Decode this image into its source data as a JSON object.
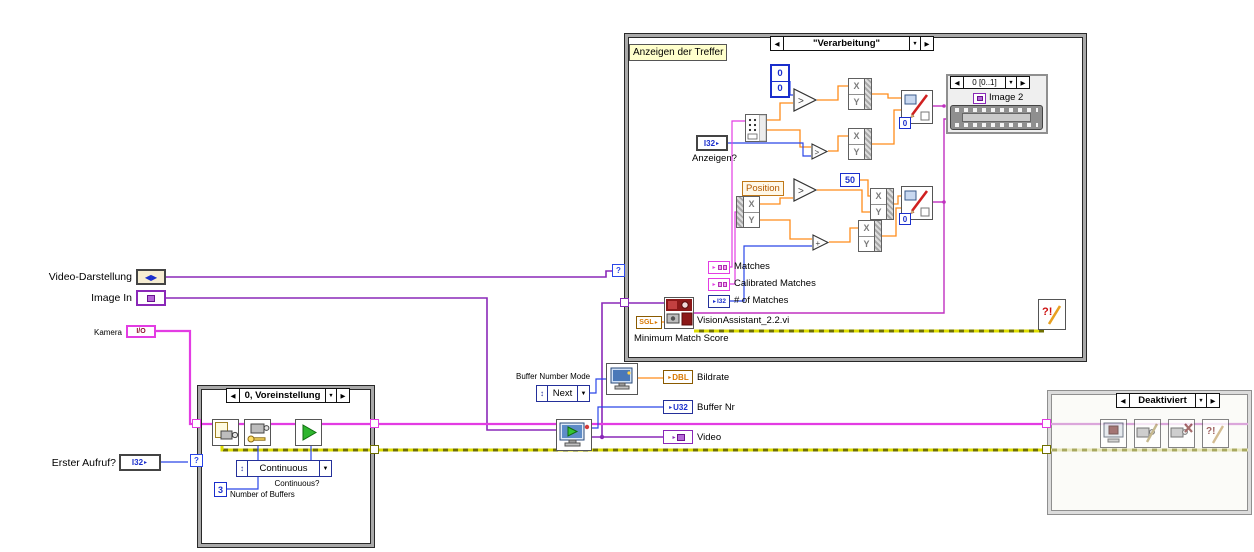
{
  "colors": {
    "wire_image": "#8a28b8",
    "wire_image_bright": "#c030c0",
    "wire_session": "#e33ce3",
    "wire_error_dark": "#6f6f00",
    "wire_error_light": "#dede00",
    "wire_numeric": "#ff8c1a",
    "wire_int": "#2a46e8",
    "type_int": "#1a2ecc",
    "type_float": "#d97800",
    "free_label_bg": "#ffffcc",
    "enum_border": "#24309a",
    "structure_border": "#a9a9a9"
  },
  "glyphs": {
    "arrow_left": "◀",
    "arrow_right": "▶",
    "arrow_down": "▼",
    "feed_arrow": "▸",
    "enum_updown": "↕",
    "question_mark": "?",
    "error_mark": "?!",
    "greater": ">",
    "add": "+",
    "x": "X",
    "y": "Y",
    "enum_lr": "◀▶"
  },
  "left_panel": {
    "video_darstellung": {
      "label": "Video-Darstellung"
    },
    "image_in": {
      "label": "Image In"
    },
    "kamera": {
      "label": "Kamera",
      "type": "I/O"
    },
    "erster_aufruf": {
      "label": "Erster Aufruf?",
      "type": "I32"
    }
  },
  "case_top": {
    "selector": "\"Verarbeitung\"",
    "free_label": "Anzeigen der Treffer",
    "array_items": [
      "0",
      "0"
    ],
    "anzeigen_type": "I32",
    "anzeigen_label": "Anzeigen?",
    "position_label": "Position",
    "const_50": "50",
    "overlay_zero": "0",
    "image_display": {
      "selector": "0 [0..1]",
      "label": "Image 2"
    },
    "vision": {
      "sgl": "SGL",
      "title": "VisionAssistant_2.2.vi",
      "out1": "Matches",
      "out2": "Calibrated Matches",
      "out3": "# of Matches",
      "out3_type": "I32",
      "min_score": "Minimum Match Score"
    }
  },
  "case_init": {
    "selector": "0, Voreinstellung",
    "enum_value": "Continuous",
    "continuous_q": "Continuous?",
    "num_buffers_value": "3",
    "num_buffers_label": "Number of Buffers"
  },
  "buffer_block": {
    "mode_label": "Buffer Number Mode",
    "enum_value": "Next",
    "out_dbl_type": "DBL",
    "out_dbl_label": "Bildrate",
    "out_u32_type": "U32",
    "out_u32_label": "Buffer Nr",
    "out_video_label": "Video"
  },
  "case_disabled": {
    "selector": "Deaktiviert"
  }
}
